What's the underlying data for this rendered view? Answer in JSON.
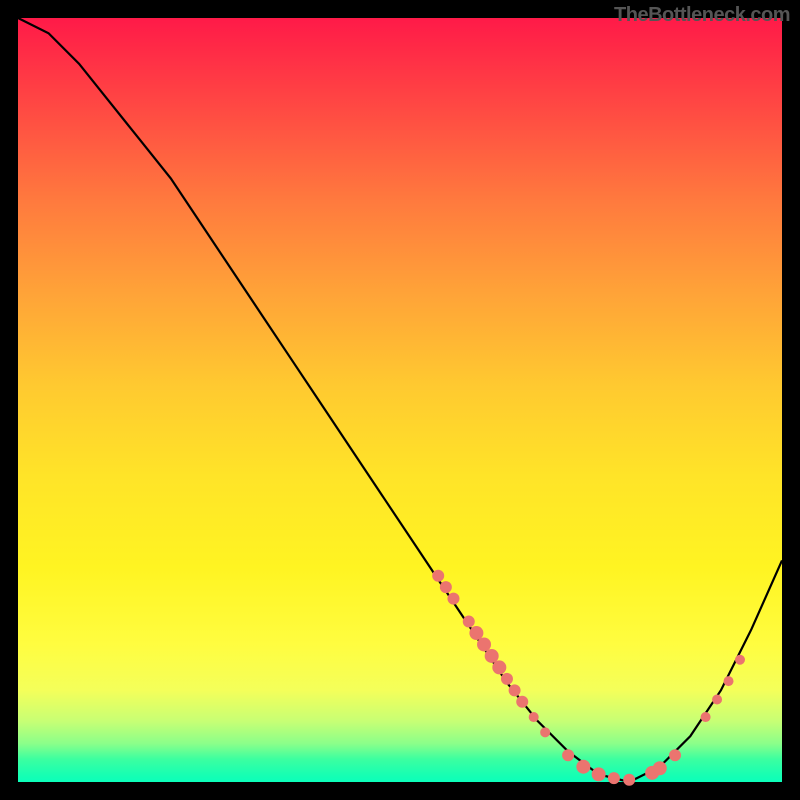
{
  "watermark": "TheBottleneck.com",
  "chart_data": {
    "type": "line",
    "title": "",
    "xlabel": "",
    "ylabel": "",
    "xlim": [
      0,
      100
    ],
    "ylim": [
      0,
      100
    ],
    "series": [
      {
        "name": "curve",
        "x": [
          0,
          4,
          8,
          12,
          16,
          20,
          24,
          28,
          32,
          36,
          40,
          44,
          48,
          52,
          56,
          60,
          64,
          68,
          72,
          76,
          80,
          84,
          88,
          92,
          96,
          100
        ],
        "values": [
          100,
          98,
          94,
          89,
          84,
          79,
          73,
          67,
          61,
          55,
          49,
          43,
          37,
          31,
          25,
          19,
          13,
          8,
          4,
          1,
          0,
          2,
          6,
          12,
          20,
          29
        ]
      }
    ],
    "markers": [
      {
        "x": 55,
        "y": 27,
        "r": 6
      },
      {
        "x": 56,
        "y": 25.5,
        "r": 6
      },
      {
        "x": 57,
        "y": 24,
        "r": 6
      },
      {
        "x": 59,
        "y": 21,
        "r": 6
      },
      {
        "x": 60,
        "y": 19.5,
        "r": 7
      },
      {
        "x": 61,
        "y": 18,
        "r": 7
      },
      {
        "x": 62,
        "y": 16.5,
        "r": 7
      },
      {
        "x": 63,
        "y": 15,
        "r": 7
      },
      {
        "x": 64,
        "y": 13.5,
        "r": 6
      },
      {
        "x": 65,
        "y": 12,
        "r": 6
      },
      {
        "x": 66,
        "y": 10.5,
        "r": 6
      },
      {
        "x": 67.5,
        "y": 8.5,
        "r": 5
      },
      {
        "x": 69,
        "y": 6.5,
        "r": 5
      },
      {
        "x": 72,
        "y": 3.5,
        "r": 6
      },
      {
        "x": 74,
        "y": 2,
        "r": 7
      },
      {
        "x": 76,
        "y": 1,
        "r": 7
      },
      {
        "x": 78,
        "y": 0.5,
        "r": 6
      },
      {
        "x": 80,
        "y": 0.3,
        "r": 6
      },
      {
        "x": 83,
        "y": 1.2,
        "r": 7
      },
      {
        "x": 84,
        "y": 1.8,
        "r": 7
      },
      {
        "x": 86,
        "y": 3.5,
        "r": 6
      },
      {
        "x": 90,
        "y": 8.5,
        "r": 5
      },
      {
        "x": 91.5,
        "y": 10.8,
        "r": 5
      },
      {
        "x": 93,
        "y": 13.2,
        "r": 5
      },
      {
        "x": 94.5,
        "y": 16,
        "r": 5
      }
    ]
  }
}
